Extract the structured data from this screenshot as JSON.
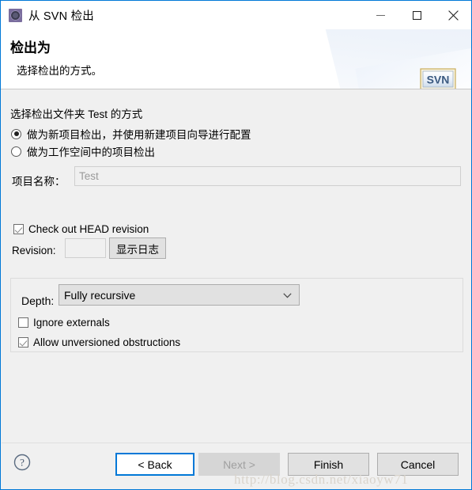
{
  "window": {
    "title": "从 SVN 检出",
    "icon": "svn-gear-icon",
    "minimize_label": "–",
    "maximize_label": "□",
    "close_label": "✕"
  },
  "header": {
    "title": "检出为",
    "subtitle": "选择检出的方式。",
    "logo_text": "SVN"
  },
  "body": {
    "section_label": "选择检出文件夹 Test 的方式",
    "radios": [
      {
        "label": "做为新项目检出，并使用新建项目向导进行配置",
        "checked": true
      },
      {
        "label": "做为工作空间中的项目检出",
        "checked": false
      }
    ],
    "project_name": {
      "label": "项目名称：",
      "value": "Test",
      "disabled": true
    },
    "head_revision": {
      "label": "Check out HEAD revision",
      "checked": true
    },
    "revision": {
      "label": "Revision:",
      "value": "",
      "disabled": true,
      "show_log_button": "显示日志"
    },
    "depth_group": {
      "depth_label": "Depth:",
      "depth_value": "Fully recursive",
      "depth_options": [
        "Fully recursive"
      ],
      "checkboxes": [
        {
          "label": "Ignore externals",
          "checked": false
        },
        {
          "label": "Allow unversioned obstructions",
          "checked": true
        }
      ]
    }
  },
  "footer": {
    "help_icon": "question-mark-icon",
    "buttons": [
      {
        "label": "< Back",
        "state": "default"
      },
      {
        "label": "Next >",
        "state": "disabled"
      },
      {
        "label": "Finish",
        "state": "normal"
      },
      {
        "label": "Cancel",
        "state": "normal"
      }
    ]
  },
  "watermark": {
    "text": "http://blog.csdn.net/xiaoyw71"
  },
  "colors": {
    "window_border": "#0078d7",
    "body_bg": "#f0f0f0",
    "header_bg": "#ffffff",
    "accent": "#0078d7"
  }
}
